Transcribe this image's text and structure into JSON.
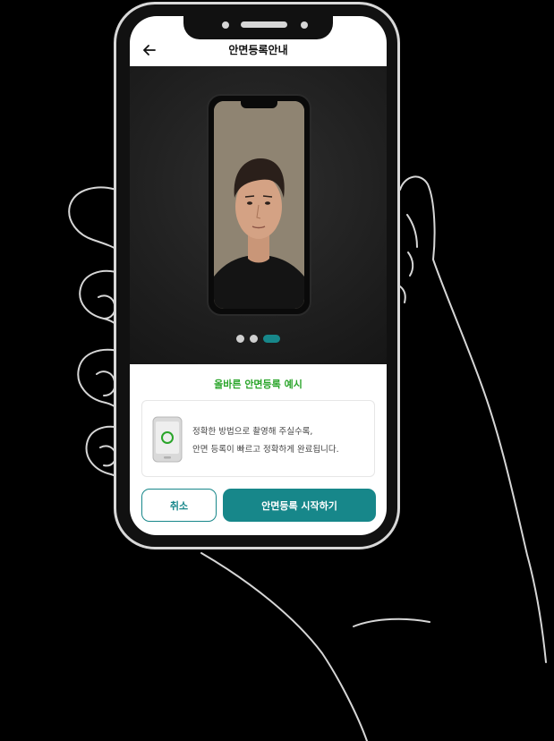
{
  "header": {
    "title": "안면등록안내"
  },
  "preview": {
    "carousel_active_index": 2,
    "carousel_count": 3
  },
  "section": {
    "subtitle": "올바른 안면등록 예시",
    "info_line_1": "정확한 방법으로 촬영해 주실수록,",
    "info_line_2": "안면 등록이 빠르고 정확하게 완료됩니다."
  },
  "buttons": {
    "cancel": "취소",
    "start": "안면등록 시작하기"
  },
  "icons": {
    "back": "arrow-left-icon",
    "info": "phone-face-scan-icon"
  },
  "colors": {
    "accent": "#17878a",
    "subtitle": "#2aa52a",
    "background": "#000000"
  }
}
